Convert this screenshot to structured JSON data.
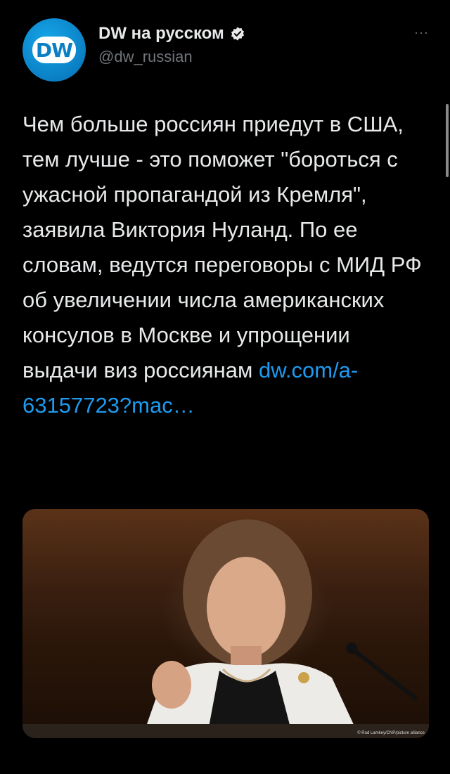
{
  "account": {
    "display_name": "DW на русском",
    "handle": "@dw_russian",
    "logo_text": "DW",
    "more_label": "···"
  },
  "tweet": {
    "text": "Чем больше россиян приедут в США, тем лучше - это поможет \"бороться с ужасной пропагандой из Кремля\", заявила Виктория Нуланд. По ее словам, ведутся переговоры с МИД РФ об увеличении числа американских консулов в Москве и упрощении выдачи виз россиянам ",
    "link_text": "dw.com/a-63157723?mac…"
  },
  "media": {
    "credit": "© Rod Lamkey/CNP/picture alliance"
  },
  "colors": {
    "background": "#000000",
    "text": "#e7e9ea",
    "secondary": "#71767b",
    "link": "#1d9bf0",
    "brand": "#0b7fc4"
  }
}
